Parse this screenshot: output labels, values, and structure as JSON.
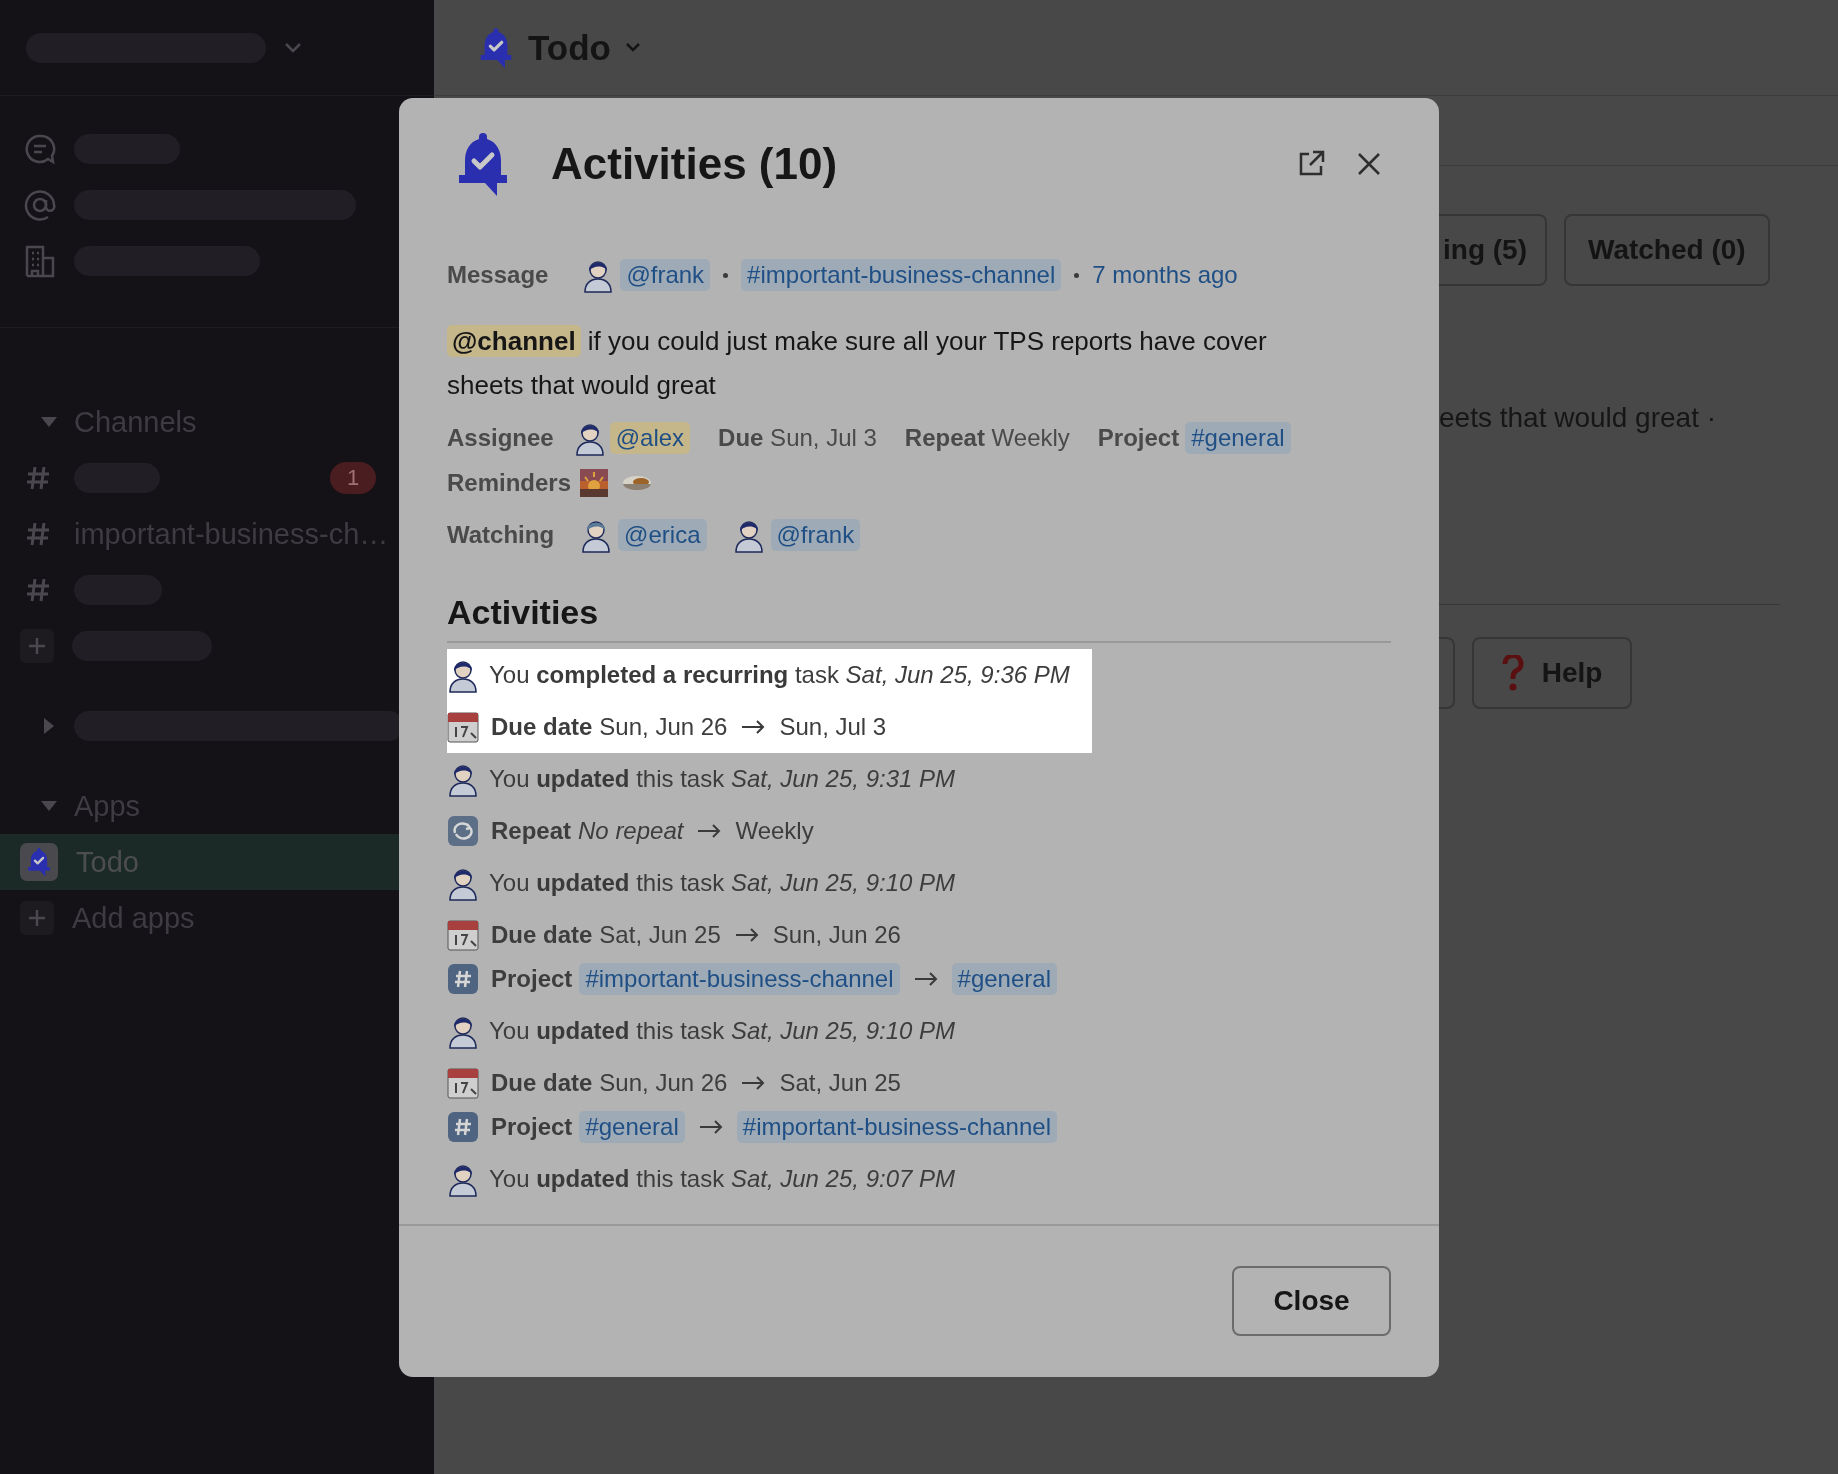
{
  "sidebar": {
    "sections": [
      {
        "title": "Channels",
        "expanded": true,
        "items": [
          {
            "kind": "placeholder",
            "badge": "1",
            "selected": false
          },
          {
            "kind": "channel",
            "name": "important-business-ch…",
            "selected": false
          },
          {
            "kind": "placeholder",
            "selected": false
          },
          {
            "kind": "add",
            "selected": false
          }
        ]
      },
      {
        "expanded": false
      },
      {
        "title": "Apps",
        "expanded": true,
        "items": [
          {
            "kind": "app",
            "name": "Todo",
            "selected": true
          },
          {
            "kind": "add",
            "name": "Add apps",
            "selected": false
          }
        ]
      }
    ]
  },
  "channel": {
    "title": "Todo",
    "filter_buttons": [
      "ing (5)",
      "Watched (0)"
    ],
    "preview_text": "eets that would great ·",
    "help_button": "Help"
  },
  "modal": {
    "title": "Activities (10)",
    "message": {
      "label": "Message",
      "author": "@frank",
      "channel": "#important-business-channel",
      "time": "7 months ago",
      "mention": "@channel",
      "text": "if you could just make sure all your TPS reports have cover sheets that would great"
    },
    "details": {
      "assignee_label": "Assignee",
      "assignee": "@alex",
      "due": "**Due** Sun, Jul 3",
      "repeat": "**Repeat** Weekly",
      "project_label": "Project",
      "project": "#general",
      "reminders_label": "Reminders",
      "watching_label": "Watching",
      "watchers": [
        "@erica",
        "@frank"
      ]
    },
    "activities_heading": "Activities",
    "activities": [
      {
        "highlighted": true,
        "text": "You **completed a recurring** task *Sat, Jun 25, 9:36 PM*",
        "changes": [
          {
            "kind": "due",
            "field": "Due date",
            "from": {
              "kind": "plain",
              "text": "Sun, Jun 26"
            },
            "to": {
              "kind": "plain",
              "text": "Sun, Jul 3"
            }
          }
        ]
      },
      {
        "highlighted": false,
        "text": "You **updated** this task *Sat, Jun 25, 9:31 PM*",
        "changes": [
          {
            "kind": "repeat",
            "field": "Repeat",
            "from": {
              "kind": "none",
              "text": "No repeat"
            },
            "to": {
              "kind": "plain",
              "text": "Weekly"
            }
          }
        ]
      },
      {
        "highlighted": false,
        "text": "You **updated** this task *Sat, Jun 25, 9:10 PM*",
        "changes": [
          {
            "kind": "due",
            "field": "Due date",
            "from": {
              "kind": "plain",
              "text": "Sat, Jun 25"
            },
            "to": {
              "kind": "plain",
              "text": "Sun, Jun 26"
            }
          },
          {
            "kind": "project",
            "field": "Project",
            "from": {
              "kind": "channel",
              "text": "#important-business-channel"
            },
            "to": {
              "kind": "channel",
              "text": "#general"
            }
          }
        ]
      },
      {
        "highlighted": false,
        "text": "You **updated** this task *Sat, Jun 25, 9:10 PM*",
        "changes": [
          {
            "kind": "due",
            "field": "Due date",
            "from": {
              "kind": "plain",
              "text": "Sun, Jun 26"
            },
            "to": {
              "kind": "plain",
              "text": "Sat, Jun 25"
            }
          },
          {
            "kind": "project",
            "field": "Project",
            "from": {
              "kind": "channel",
              "text": "#general"
            },
            "to": {
              "kind": "channel",
              "text": "#important-business-channel"
            }
          }
        ]
      },
      {
        "highlighted": false,
        "text": "You **updated** this task *Sat, Jun 25, 9:07 PM*"
      }
    ],
    "close_button": "Close"
  }
}
